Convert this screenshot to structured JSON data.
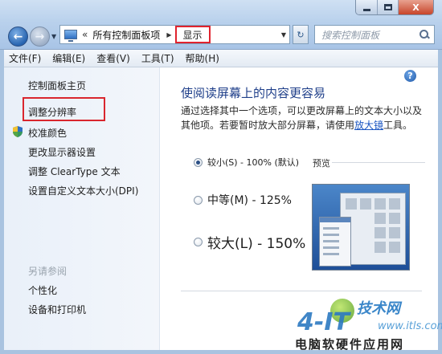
{
  "window": {
    "caption_buttons": {
      "minimize": "minimize-icon",
      "maximize": "maximize-icon",
      "close": "X"
    }
  },
  "nav": {
    "back_icon": "back-arrow-icon",
    "forward_icon": "forward-arrow-icon"
  },
  "address": {
    "separator": "«",
    "crumb": "所有控制面板项",
    "caret": "▶",
    "current": "显示"
  },
  "search": {
    "placeholder": "搜索控制面板"
  },
  "menu": [
    "文件(F)",
    "编辑(E)",
    "查看(V)",
    "工具(T)",
    "帮助(H)"
  ],
  "sidebar": {
    "items": [
      "控制面板主页",
      "调整分辨率",
      "校准颜色",
      "更改显示器设置",
      "调整 ClearType 文本",
      "设置自定义文本大小(DPI)"
    ],
    "see_also_title": "另请参阅",
    "see_also": [
      "个性化",
      "设备和打印机"
    ]
  },
  "main": {
    "help": "?",
    "title": "使阅读屏幕上的内容更容易",
    "desc_before": "通过选择其中一个选项，可以更改屏幕上的文本大小以及其他项。若要暂时放大部分屏幕，请使用",
    "desc_link": "放大镜",
    "desc_after": "工具。",
    "options": [
      {
        "label": "较小(S) - 100% (默认)",
        "checked": true
      },
      {
        "label": "中等(M) - 125%",
        "checked": false
      },
      {
        "label": "较大(L) - 150%",
        "checked": false
      }
    ],
    "preview_label": "预览"
  },
  "watermark": {
    "brand": "技术网",
    "big": "4-IT",
    "url": "www.itls.com",
    "footer": "电脑软硬件应用网"
  },
  "colors": {
    "highlight": "#d9262e",
    "title_blue": "#1f3f8a",
    "link": "#1b56c2"
  }
}
